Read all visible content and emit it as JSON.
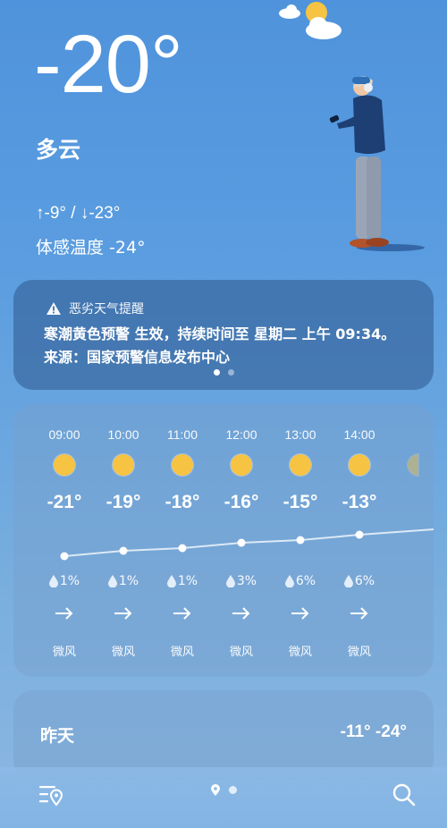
{
  "current": {
    "temperature": "-20°",
    "condition": "多云",
    "high_low": "↑-9° / ↓-23°",
    "feels_like": "体感温度 -24°"
  },
  "alert": {
    "title": "恶劣天气提醒",
    "message": "寒潮黄色预警 生效，持续时间至 星期二 上午 09:34。来源：国家预警信息发布中心",
    "icon": "warning-icon",
    "page_index": 0,
    "page_count": 2
  },
  "hourly": [
    {
      "time": "09:00",
      "temp": "-21°",
      "rain": "1%",
      "wind": "微风",
      "icon": "sun-icon"
    },
    {
      "time": "10:00",
      "temp": "-19°",
      "rain": "1%",
      "wind": "微风",
      "icon": "sun-icon"
    },
    {
      "time": "11:00",
      "temp": "-18°",
      "rain": "1%",
      "wind": "微风",
      "icon": "sun-icon"
    },
    {
      "time": "12:00",
      "temp": "-16°",
      "rain": "3%",
      "wind": "微风",
      "icon": "sun-icon"
    },
    {
      "time": "13:00",
      "temp": "-15°",
      "rain": "6%",
      "wind": "微风",
      "icon": "sun-icon"
    },
    {
      "time": "14:00",
      "temp": "-13°",
      "rain": "6%",
      "wind": "微风",
      "icon": "sun-icon"
    }
  ],
  "yesterday": {
    "label": "昨天",
    "range": "-11° -24°"
  },
  "bottom_nav": {
    "city_list_icon": "city-list-icon",
    "search_icon": "search-icon",
    "page_index": 0,
    "page_count": 2
  },
  "colors": {
    "background_top": "#4f93dc",
    "background_bottom": "#8db7e2",
    "sun": "#f6c343",
    "jacket": "#1e3f73",
    "pants": "#9aa6b8"
  }
}
